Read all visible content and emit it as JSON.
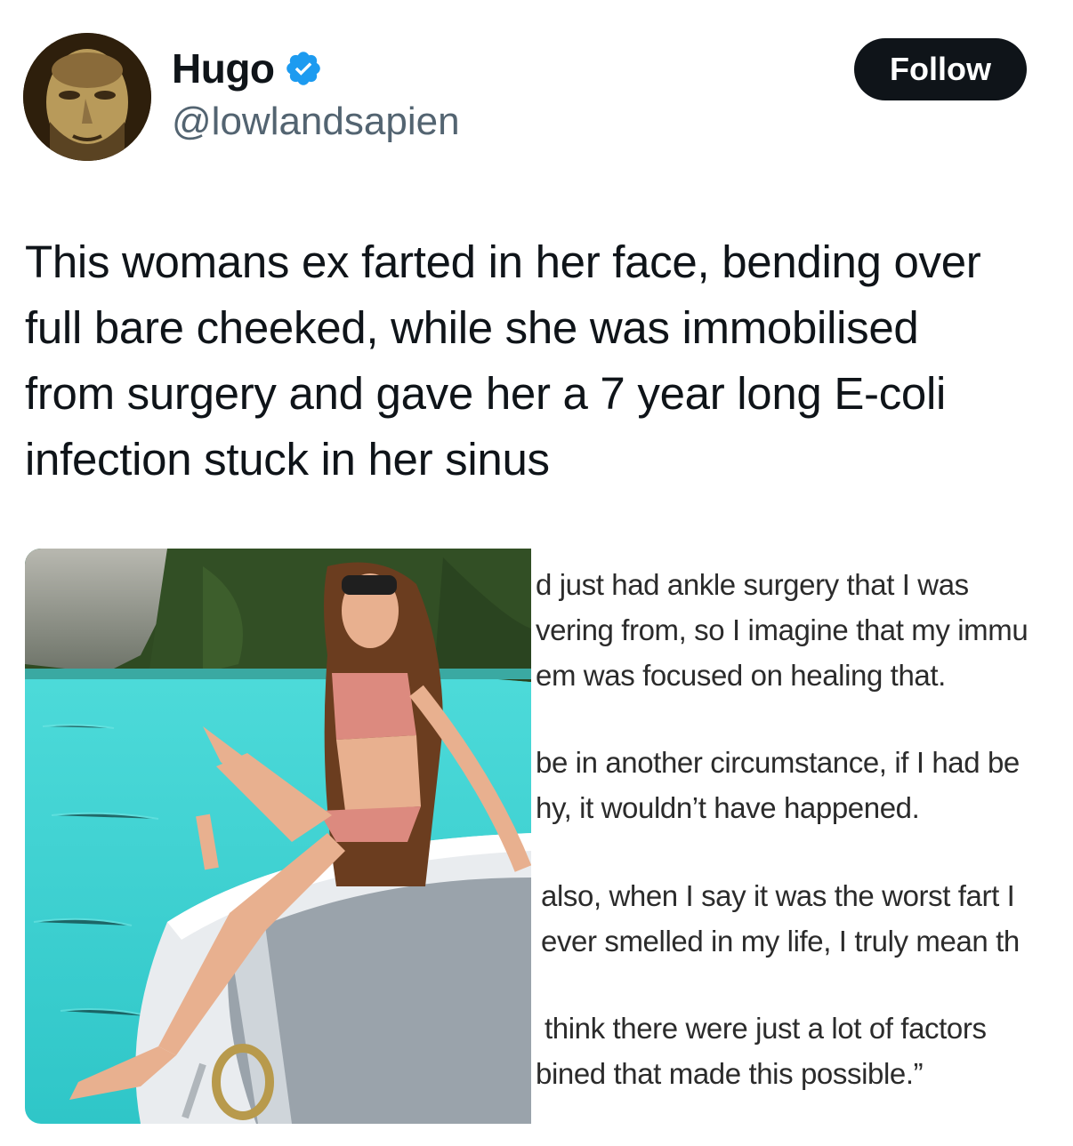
{
  "author": {
    "name": "Hugo",
    "handle": "@lowlandsapien",
    "verified": true,
    "verified_icon": "verified-badge-icon",
    "verified_color": "#1d9bf0"
  },
  "follow_label": "Follow",
  "tweet": {
    "lines": [
      "This womans ex farted in her face, bending over",
      "full bare cheeked, while she was immobilised",
      "from surgery and gave her a 7 year long E-coli",
      "infection stuck in her sinus"
    ]
  },
  "media": {
    "quote_lines": [
      "d just had ankle surgery that I was",
      "vering from, so I imagine that my immu",
      "em was focused on healing that.",
      "be in another circumstance, if I had be",
      "hy, it wouldn’t have happened.",
      "also, when I say it was the worst fart I",
      "ever smelled in my life, I truly mean th",
      "think there were just a lot of factors",
      "bined that made this possible.”"
    ]
  },
  "colors": {
    "text": "#0f1419",
    "secondary": "#536471",
    "follow_bg": "#0f1419",
    "water": "#40d6d2"
  }
}
